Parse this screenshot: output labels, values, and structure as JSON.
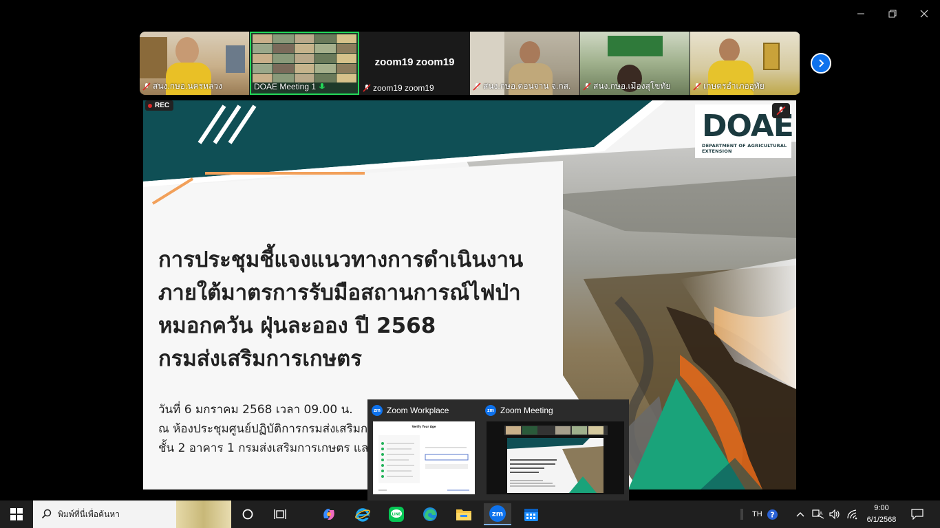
{
  "participants": [
    {
      "name": "สนง.กษอ.นครหลวง"
    },
    {
      "name": "DOAE Meeting 1"
    },
    {
      "name": "zoom19 zoom19",
      "display_name": "zoom19 zoom19"
    },
    {
      "name": "สนง.กษอ.ดอนจาน จ.กส."
    },
    {
      "name": "สนง.กษอ.เมืองสุโขทัย"
    },
    {
      "name": "เกษตรอำเภออุทัย"
    }
  ],
  "share": {
    "rec_label": "REC",
    "logo_main": "DOAE",
    "logo_sub": "DEPARTMENT OF AGRICULTURAL EXTENSION",
    "title_lines": [
      "การประชุมชี้แจงแนวทางการดำเนินงาน",
      "ภายใต้มาตรการรับมือสถานการณ์ไฟป่า",
      "หมอกควัน ฝุ่นละออง ปี 2568",
      "กรมส่งเสริมการเกษตร"
    ],
    "sub_lines": [
      "วันที่ 6 มกราคม 2568 เวลา 09.00 น.",
      "ณ ห้องประชุมศูนย์ปฏิบัติการกรมส่งเสริมก",
      "ชั้น 2 อาคาร 1 กรมส่งเสริมการเกษตร และ"
    ]
  },
  "previews": [
    {
      "title": "Zoom Workplace",
      "thumb_title": "Verify Your Age"
    },
    {
      "title": "Zoom Meeting"
    }
  ],
  "taskbar": {
    "search_placeholder": "พิมพ์ที่นี่เพื่อค้นหา",
    "zoom_badge": "zm",
    "language": "TH",
    "time": "9:00",
    "date": "6/1/2568"
  },
  "colors": {
    "accent_green": "#23d959",
    "zoom_blue": "#0e72ed",
    "slide_teal": "#0f4f55",
    "slide_green": "#1aa37a",
    "slide_orange": "#f2a05a"
  }
}
